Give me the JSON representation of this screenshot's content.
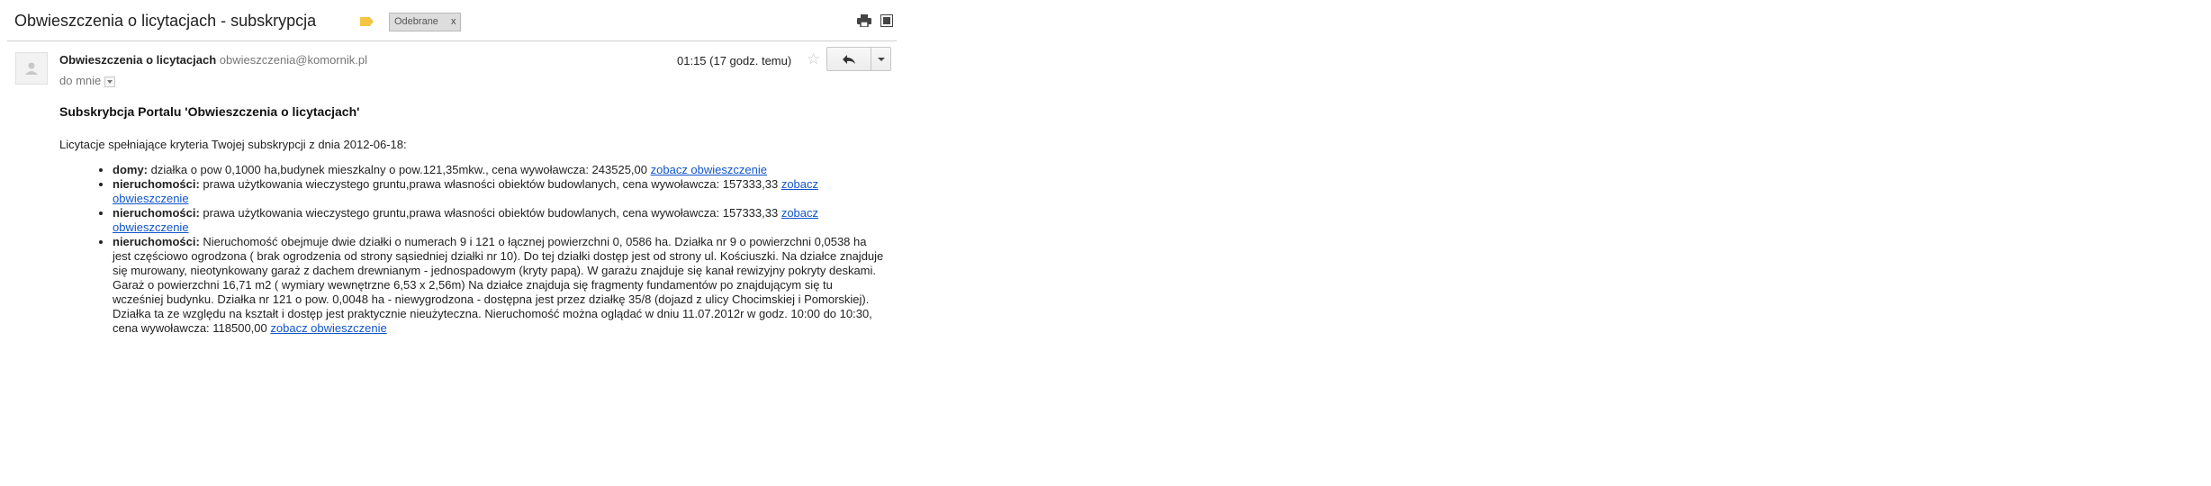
{
  "header": {
    "subject": "Obwieszczenia o licytacjach - subskrypcja",
    "label_color": "#f4c542",
    "inbox_label": "Odebrane",
    "inbox_label_close": "x",
    "print_icon": "print-icon",
    "new_window_icon": "new-window-icon"
  },
  "message": {
    "sender_name": "Obwieszczenia o licytacjach",
    "sender_email": "obwieszczenia@komornik.pl",
    "to_text": "do mnie",
    "time": "01:15 (17 godz. temu)",
    "star_icon": "star-icon",
    "reply_icon": "reply-icon",
    "more_icon": "chevron-down-icon"
  },
  "body": {
    "title": "Subskrybcja Portalu 'Obwieszczenia o licytacjach'",
    "intro": "Licytacje spełniające kryteria Twojej subskrypcji z dnia 2012-06-18:",
    "link_color": "#1155cc",
    "items": [
      {
        "category": "domy:",
        "text": " działka o pow 0,1000 ha,budynek mieszkalny o pow.121,35mkw., cena wywoławcza: 243525,00 ",
        "link": "zobacz obwieszczenie"
      },
      {
        "category": "nieruchomości:",
        "text": " prawa użytkowania wieczystego gruntu,prawa własności obiektów budowlanych, cena wywoławcza: 157333,33 ",
        "link": "zobacz obwieszczenie"
      },
      {
        "category": "nieruchomości:",
        "text": " prawa użytkowania wieczystego gruntu,prawa własności obiektów budowlanych, cena wywoławcza: 157333,33 ",
        "link": "zobacz obwieszczenie"
      },
      {
        "category": "nieruchomości:",
        "text": " Nieruchomość obejmuje dwie działki o numerach 9 i 121 o łącznej powierzchni 0, 0586 ha. Działka nr 9 o powierzchni 0,0538 ha jest częściowo ogrodzona ( brak ogrodzenia od strony sąsiedniej działki nr 10). Do tej działki dostęp jest od strony ul. Kościuszki. Na działce znajduje się murowany, nieotynkowany garaż z dachem drewnianym - jednospadowym (kryty papą). W garażu znajduje się kanał rewizyjny pokryty deskami. Garaż o powierzchni 16,71 m2 ( wymiary wewnętrzne 6,53 x 2,56m) Na działce znajduja się fragmenty fundamentów po znajdującym się tu wcześniej budynku. Działka nr 121 o pow. 0,0048 ha - niewygrodzona - dostępna jest przez działkę 35/8 (dojazd z ulicy Chocimskiej i Pomorskiej). Działka ta ze względu na kształt i dostęp jest praktycznie nieużyteczna. Nieruchomość można oglądać w dniu 11.07.2012r w godz. 10:00 do 10:30, cena wywoławcza: 118500,00 ",
        "link": "zobacz obwieszczenie"
      }
    ]
  }
}
